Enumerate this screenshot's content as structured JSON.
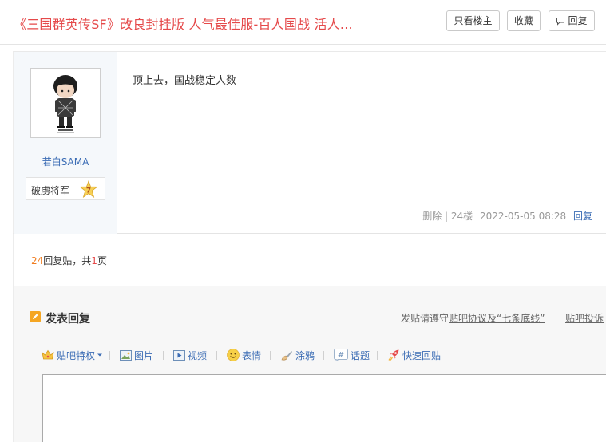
{
  "header": {
    "title": "《三国群英传SF》改良封挂版 人气最佳服-百人国战 活人...",
    "only_op_label": "只看楼主",
    "favorite_label": "收藏",
    "reply_label": "回复"
  },
  "post": {
    "username": "若白SAMA",
    "rank_title": "破虏将军",
    "rank_level": "7",
    "content": "顶上去，国战稳定人数",
    "delete_label": "删除",
    "separator": "|",
    "floor": "24楼",
    "datetime": "2022-05-05 08:28",
    "reply_label": "回复"
  },
  "pager": {
    "reply_count": "24",
    "reply_text": "回复贴，共",
    "page_count": "1",
    "page_unit": "页"
  },
  "reply_box": {
    "title": "发表回复",
    "rules_prefix": "发贴请遵守",
    "rules_link": "贴吧协议及“七条底线”",
    "complain": "贴吧投诉"
  },
  "toolbar": {
    "privilege": "贴吧特权",
    "image": "图片",
    "video": "视频",
    "emoji": "表情",
    "doodle": "涂鸦",
    "topic": "话题",
    "quick_reply": "快速回贴"
  },
  "colors": {
    "title_red": "#e5494a",
    "link_blue": "#3c6db5",
    "orange": "#f07c1f"
  }
}
